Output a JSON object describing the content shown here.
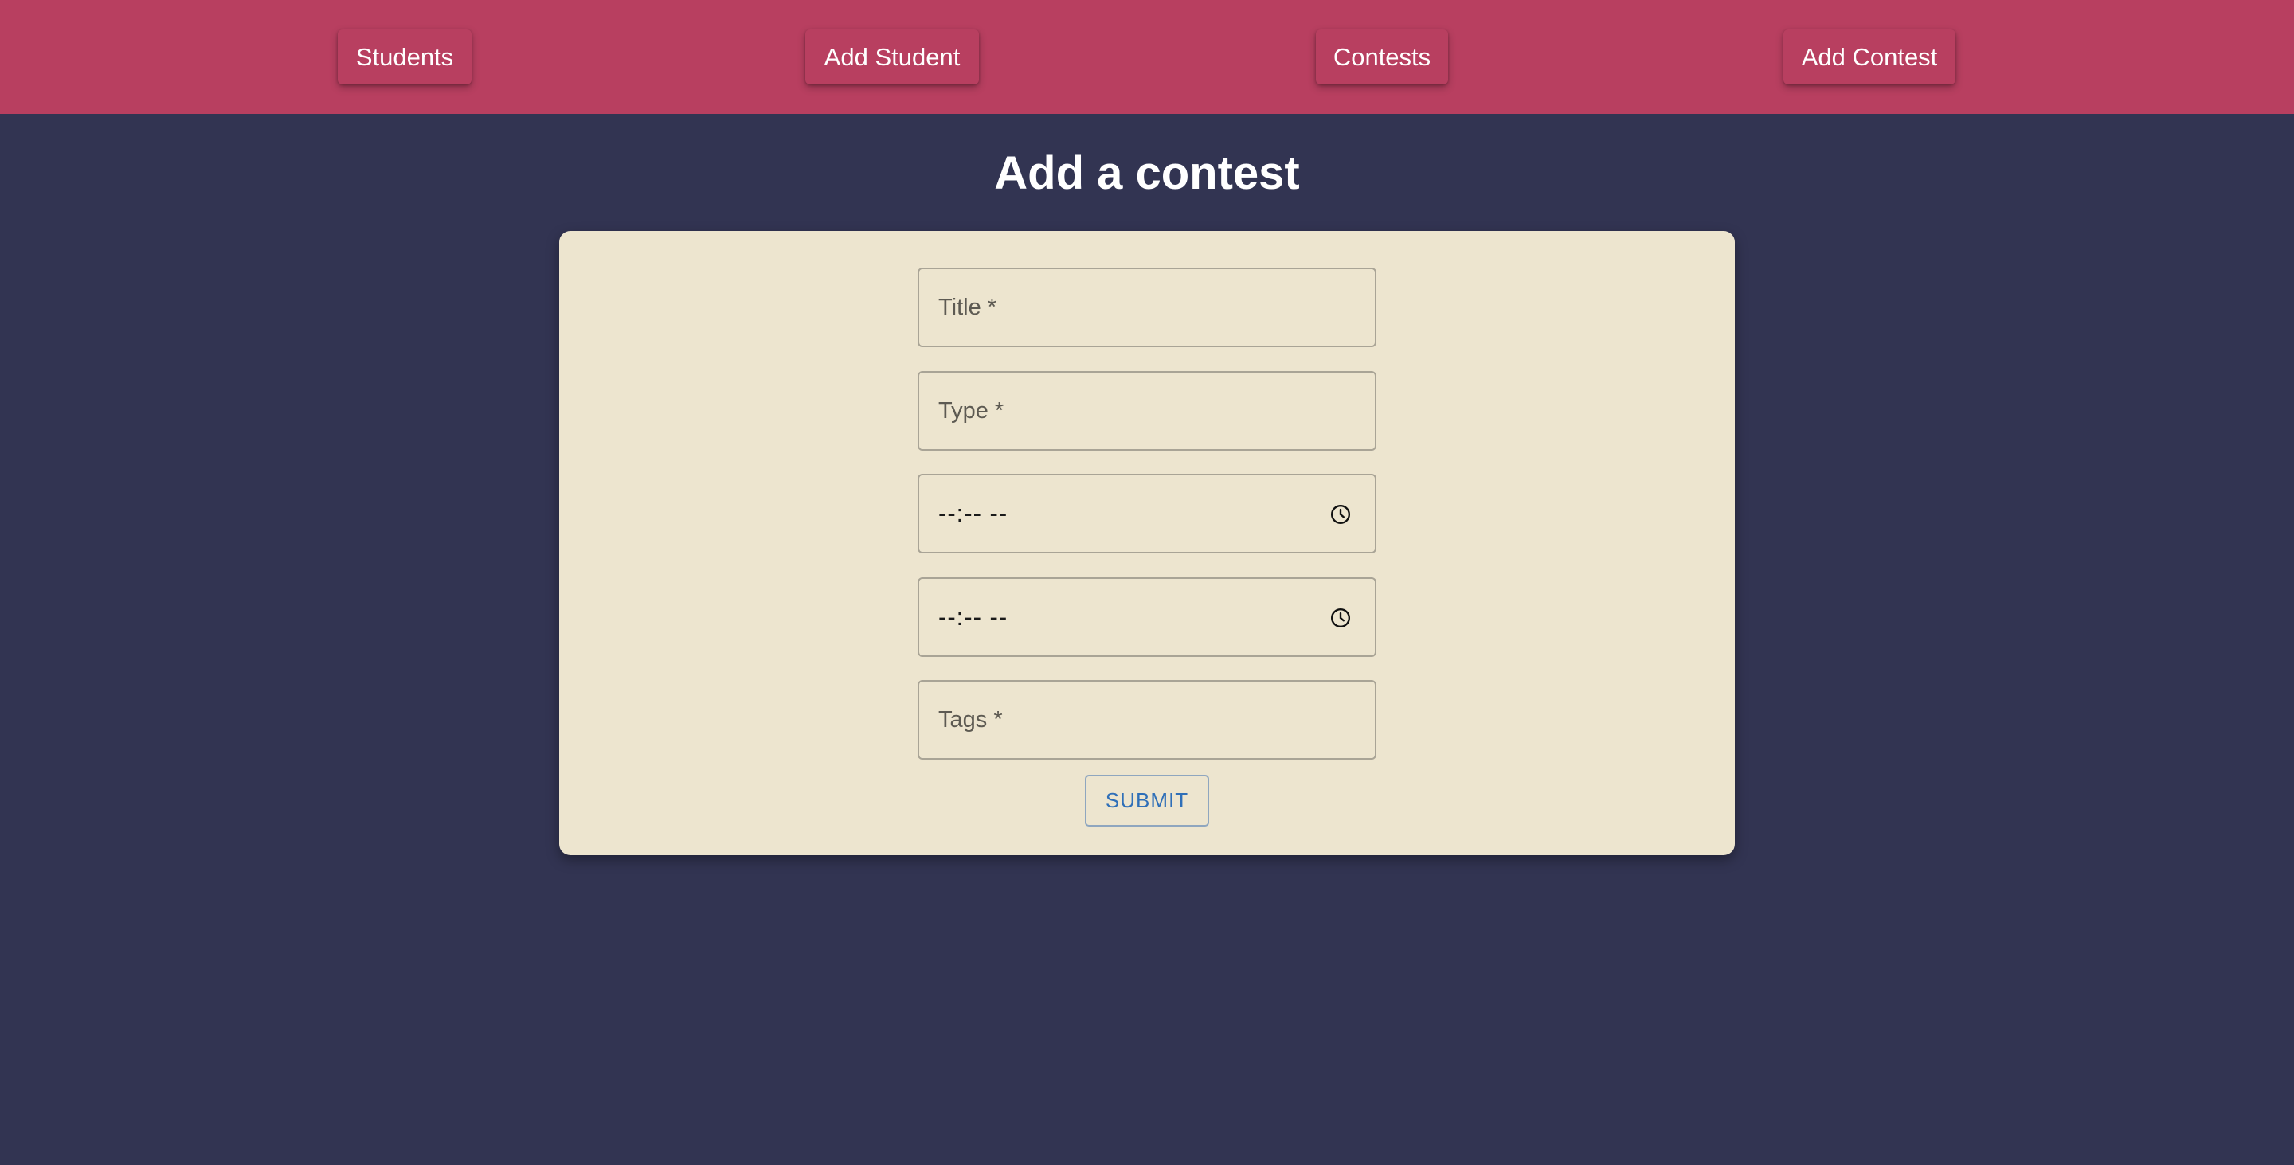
{
  "nav": {
    "items": [
      {
        "label": "Students"
      },
      {
        "label": "Add Student"
      },
      {
        "label": "Contests"
      },
      {
        "label": "Add Contest"
      }
    ]
  },
  "page": {
    "title": "Add a contest"
  },
  "form": {
    "title_placeholder": "Title *",
    "type_placeholder": "Type *",
    "start_time_value": "--:-- --",
    "end_time_value": "--:-- --",
    "tags_placeholder": "Tags *",
    "submit_label": "SUBMIT"
  },
  "icons": {
    "time_icon": "clock-icon"
  },
  "colors": {
    "topbar": "#b83f60",
    "background": "#323452",
    "card": "#ede5cf",
    "submit_text": "#2f6fb8"
  }
}
